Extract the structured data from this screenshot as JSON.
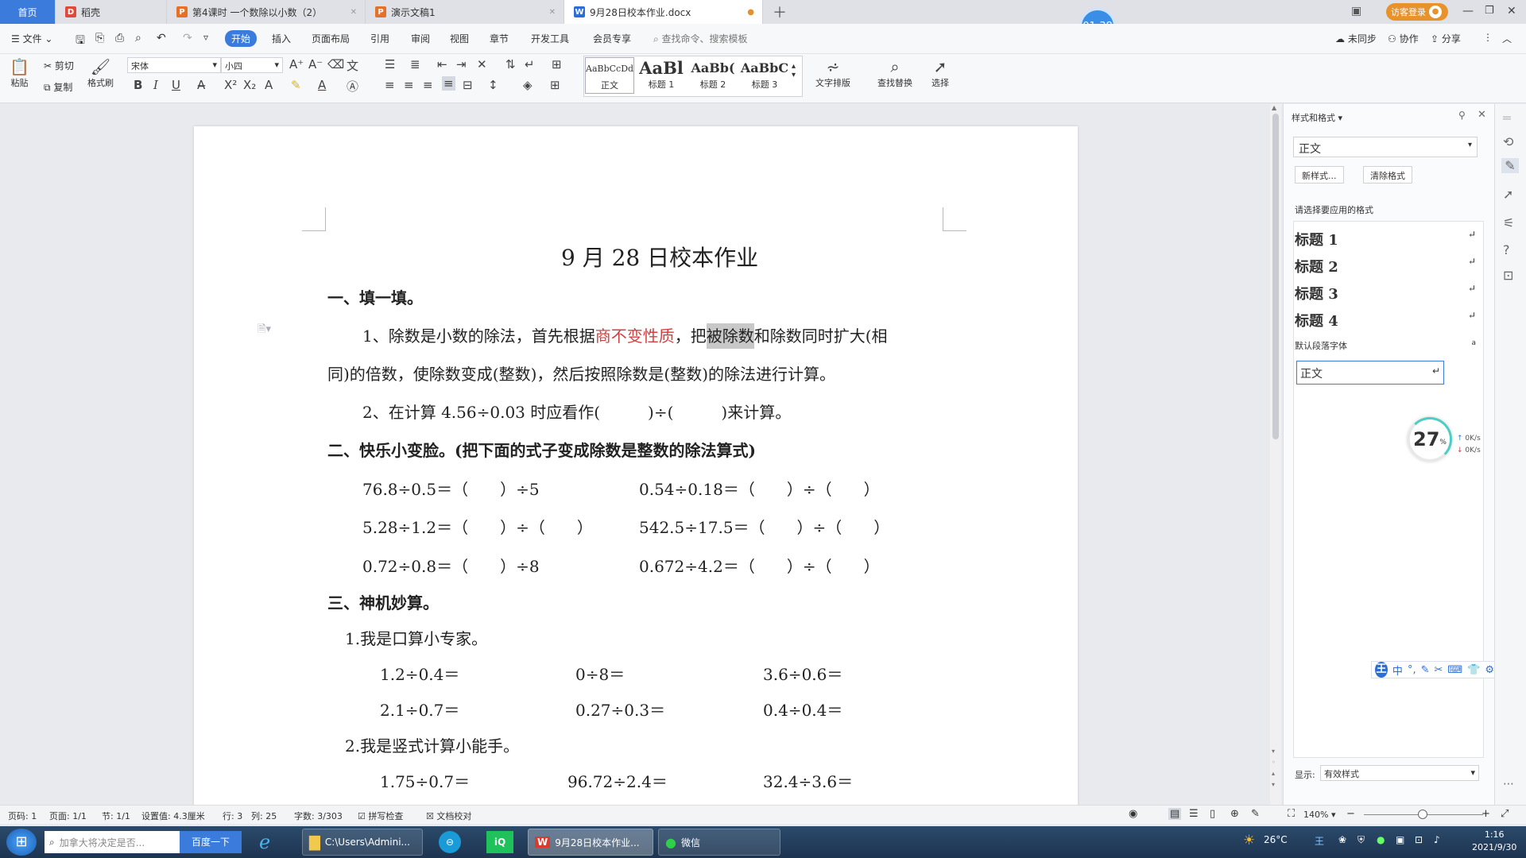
{
  "tabs": [
    {
      "label": "首页",
      "kind": "home"
    },
    {
      "label": "稻壳",
      "icon": "D",
      "color": "#e04a3a"
    },
    {
      "label": "第4课时 一个数除以小数（2）",
      "icon": "P",
      "color": "#e5702a"
    },
    {
      "label": "演示文稿1",
      "icon": "P",
      "color": "#e5702a"
    },
    {
      "label": "9月28日校本作业.docx",
      "icon": "W",
      "color": "#2b6fd6"
    }
  ],
  "timer": "01:38",
  "login": "访客登录",
  "menu": {
    "file": "文件",
    "items": [
      "开始",
      "插入",
      "页面布局",
      "引用",
      "审阅",
      "视图",
      "章节",
      "开发工具",
      "会员专享"
    ],
    "search": "查找命令、搜索模板",
    "sync": "未同步",
    "collab": "协作",
    "share": "分享"
  },
  "ribbon": {
    "paste": "粘贴",
    "cut": "剪切",
    "copy": "复制",
    "painter": "格式刷",
    "font": "宋体",
    "size": "小四",
    "styles": [
      {
        "sample": "AaBbCcDd",
        "name": "正文"
      },
      {
        "sample": "AaBl",
        "name": "标题 1"
      },
      {
        "sample": "AaBb(",
        "name": "标题 2"
      },
      {
        "sample": "AaBbC",
        "name": "标题 3"
      }
    ],
    "layout": "文字排版",
    "find": "查找替换",
    "select": "选择"
  },
  "doc": {
    "title": "9 月 28 日校本作业",
    "s1": "一、填一填。",
    "q1a": "1、除数是小数的除法，首先根据",
    "q1red": "商不变性质",
    "q1b": "，把",
    "q1sel": "被除数",
    "q1c": "和除数同时扩大(相",
    "q1d": "同)的倍数，使除数变成(整数)，然后按照除数是(整数)的除法进行计算。",
    "q2": "2、在计算 4.56÷0.03 时应看作(　　　)÷(　　　)来计算。",
    "s2": "二、快乐小变脸。(把下面的式子变成除数是整数的除法算式)",
    "r1a": "76.8÷0.5＝（　　）÷5",
    "r1b": "0.54÷0.18＝（　　）÷（　　）",
    "r2a": "5.28÷1.2＝（　　）÷（　　）",
    "r2b": "542.5÷17.5＝（　　）÷（　　）",
    "r3a": "0.72÷0.8＝（　　）÷8",
    "r3b": "0.672÷4.2＝（　　）÷（　　）",
    "s3": "三、神机妙算。",
    "p1": "1.我是口算小专家。",
    "m1": [
      "1.2÷0.4＝",
      "0÷8＝",
      "3.6÷0.6＝"
    ],
    "m2": [
      "2.1÷0.7＝",
      "0.27÷0.3＝",
      "0.4÷0.4＝"
    ],
    "p2": "2.我是竖式计算小能手。",
    "m3": [
      "1.75÷0.7＝",
      "96.72÷2.4＝",
      "32.4÷3.6＝"
    ]
  },
  "panel": {
    "title": "样式和格式",
    "current": "正文",
    "newstyle": "新样式...",
    "clear": "清除格式",
    "prompt": "请选择要应用的格式",
    "items": [
      "标题 1",
      "标题 2",
      "标题 3",
      "标题 4"
    ],
    "default_font": "默认段落字体",
    "body": "正文",
    "show_label": "显示:",
    "show_value": "有效样式",
    "net_percent": "27",
    "net_up": "0K/s",
    "net_down": "0K/s"
  },
  "status": {
    "page": "页码: 1",
    "pages": "页面: 1/1",
    "section": "节: 1/1",
    "setting": "设置值: 4.3厘米",
    "row": "行: 3",
    "col": "列: 25",
    "words": "字数: 3/303",
    "spell": "拼写检查",
    "proof": "文档校对",
    "zoom": "140%"
  },
  "taskbar": {
    "search": "加拿大将决定是否...",
    "baidu": "百度一下",
    "explorer": "C:\\Users\\Admini...",
    "word": "9月28日校本作业...",
    "wechat": "微信",
    "temp": "26°C",
    "time": "1:16",
    "date": "2021/9/30"
  },
  "ime": {
    "lang": "中"
  }
}
